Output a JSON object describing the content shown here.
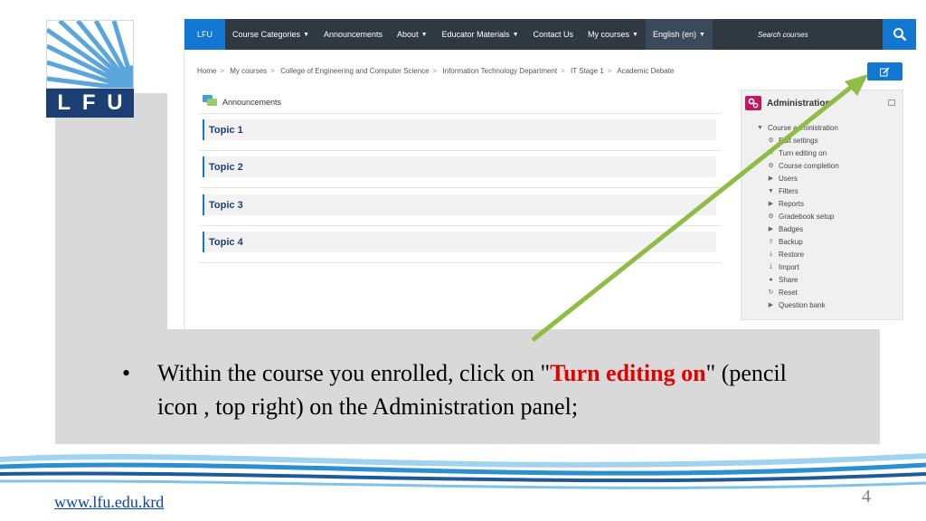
{
  "logo": {
    "letters": [
      "L",
      "F",
      "U"
    ]
  },
  "navbar": {
    "items": [
      {
        "label": "LFU",
        "caret": false
      },
      {
        "label": "Course Categories",
        "caret": true
      },
      {
        "label": "Announcements",
        "caret": false
      },
      {
        "label": "About",
        "caret": true
      },
      {
        "label": "Educator Materials",
        "caret": true
      },
      {
        "label": "Contact Us",
        "caret": false
      },
      {
        "label": "My courses",
        "caret": true
      },
      {
        "label": "English (en)",
        "caret": true
      }
    ],
    "search_placeholder": "Search courses"
  },
  "breadcrumb": [
    "Home",
    "My courses",
    "College of Engineering and Computer Science",
    "Information Technology Department",
    "IT Stage 1",
    "Academic Debate"
  ],
  "announcements_label": "Announcements",
  "topics": [
    "Topic 1",
    "Topic 2",
    "Topic 3",
    "Topic 4"
  ],
  "admin": {
    "title": "Administration",
    "items": [
      {
        "label": "Course administration",
        "icon": "caret-down-icon",
        "level": 0
      },
      {
        "label": "Edit settings",
        "icon": "gear-icon",
        "level": 1
      },
      {
        "label": "Turn editing on",
        "icon": "pencil-icon",
        "level": 1
      },
      {
        "label": "Course completion",
        "icon": "gear-icon",
        "level": 1
      },
      {
        "label": "Users",
        "icon": "caret-right-icon",
        "level": 1
      },
      {
        "label": "Filters",
        "icon": "filter-icon",
        "level": 1
      },
      {
        "label": "Reports",
        "icon": "caret-right-icon",
        "level": 1
      },
      {
        "label": "Gradebook setup",
        "icon": "gear-icon",
        "level": 1
      },
      {
        "label": "Badges",
        "icon": "caret-right-icon",
        "level": 1
      },
      {
        "label": "Backup",
        "icon": "upload-icon",
        "level": 1
      },
      {
        "label": "Restore",
        "icon": "download-icon",
        "level": 1
      },
      {
        "label": "Import",
        "icon": "download-icon",
        "level": 1
      },
      {
        "label": "Share",
        "icon": "share-icon",
        "level": 1
      },
      {
        "label": "Reset",
        "icon": "reset-icon",
        "level": 1
      },
      {
        "label": "Question bank",
        "icon": "caret-right-icon",
        "level": 1
      }
    ]
  },
  "instruction": {
    "bullet": "•",
    "line1_before": "Within the course you enrolled, click on \"",
    "highlight": "Turn editing on",
    "line1_after": "\" (pencil",
    "line2": "icon , top right) on the Administration panel;"
  },
  "footer": {
    "link": "www.lfu.edu.krd",
    "page_number": "4"
  },
  "colors": {
    "accent": "#1177d1",
    "navbar": "#303841",
    "highlight": "#e30000",
    "arrow": "#8fbc45",
    "logo_blue": "#1c3f73"
  }
}
